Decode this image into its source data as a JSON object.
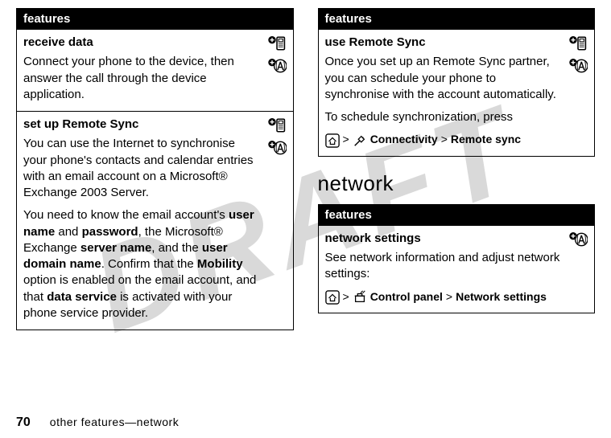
{
  "watermark": "DRAFT",
  "left": {
    "header": "features",
    "items": [
      {
        "title": "receive data",
        "paras": [
          [
            {
              "t": "Connect your phone to the device, then answer the call through the device application."
            }
          ]
        ],
        "icons": [
          "phone-plus",
          "a-plus"
        ]
      },
      {
        "title": "set up Remote Sync",
        "paras": [
          [
            {
              "t": "You can use the Internet to synchronise your phone's contacts and calendar entries with an email account on a Microsoft® Exchange 2003 Server."
            }
          ],
          [
            {
              "t": "You need to know the email account's "
            },
            {
              "t": "user name",
              "b": true
            },
            {
              "t": " and "
            },
            {
              "t": "password",
              "b": true
            },
            {
              "t": ", the Microsoft® Exchange "
            },
            {
              "t": "server name",
              "b": true
            },
            {
              "t": ", and the "
            },
            {
              "t": "user domain name",
              "b": true
            },
            {
              "t": ". Confirm that the "
            },
            {
              "t": "Mobility",
              "b": true
            },
            {
              "t": " option is enabled on the email account, and that "
            },
            {
              "t": "data service",
              "b": true
            },
            {
              "t": " is activated with your phone service provider."
            }
          ]
        ],
        "icons": [
          "phone-plus",
          "a-plus"
        ]
      }
    ]
  },
  "right": {
    "header": "features",
    "items": [
      {
        "title": "use Remote Sync",
        "paras": [
          [
            {
              "t": "Once you set up an Remote Sync partner, you can schedule your phone to synchronise with the account automatically."
            }
          ],
          [
            {
              "t": "To schedule synchronization, press"
            }
          ]
        ],
        "path": {
          "pre_icon": "home-icon",
          "mid_icon": "connectivity-icon",
          "seg1": "Connectivity",
          "seg2": "Remote sync"
        },
        "icons": [
          "phone-plus",
          "a-plus"
        ]
      }
    ],
    "section_heading": "network",
    "header2": "features",
    "items2": [
      {
        "title": "network settings",
        "paras": [
          [
            {
              "t": "See network information and adjust network settings:"
            }
          ]
        ],
        "path": {
          "pre_icon": "home-icon",
          "mid_icon": "toolbox-icon",
          "seg1": "Control panel",
          "seg2": "Network settings"
        },
        "icons": [
          "a-plus"
        ]
      }
    ]
  },
  "footer": {
    "page": "70",
    "text": "other features—network"
  }
}
